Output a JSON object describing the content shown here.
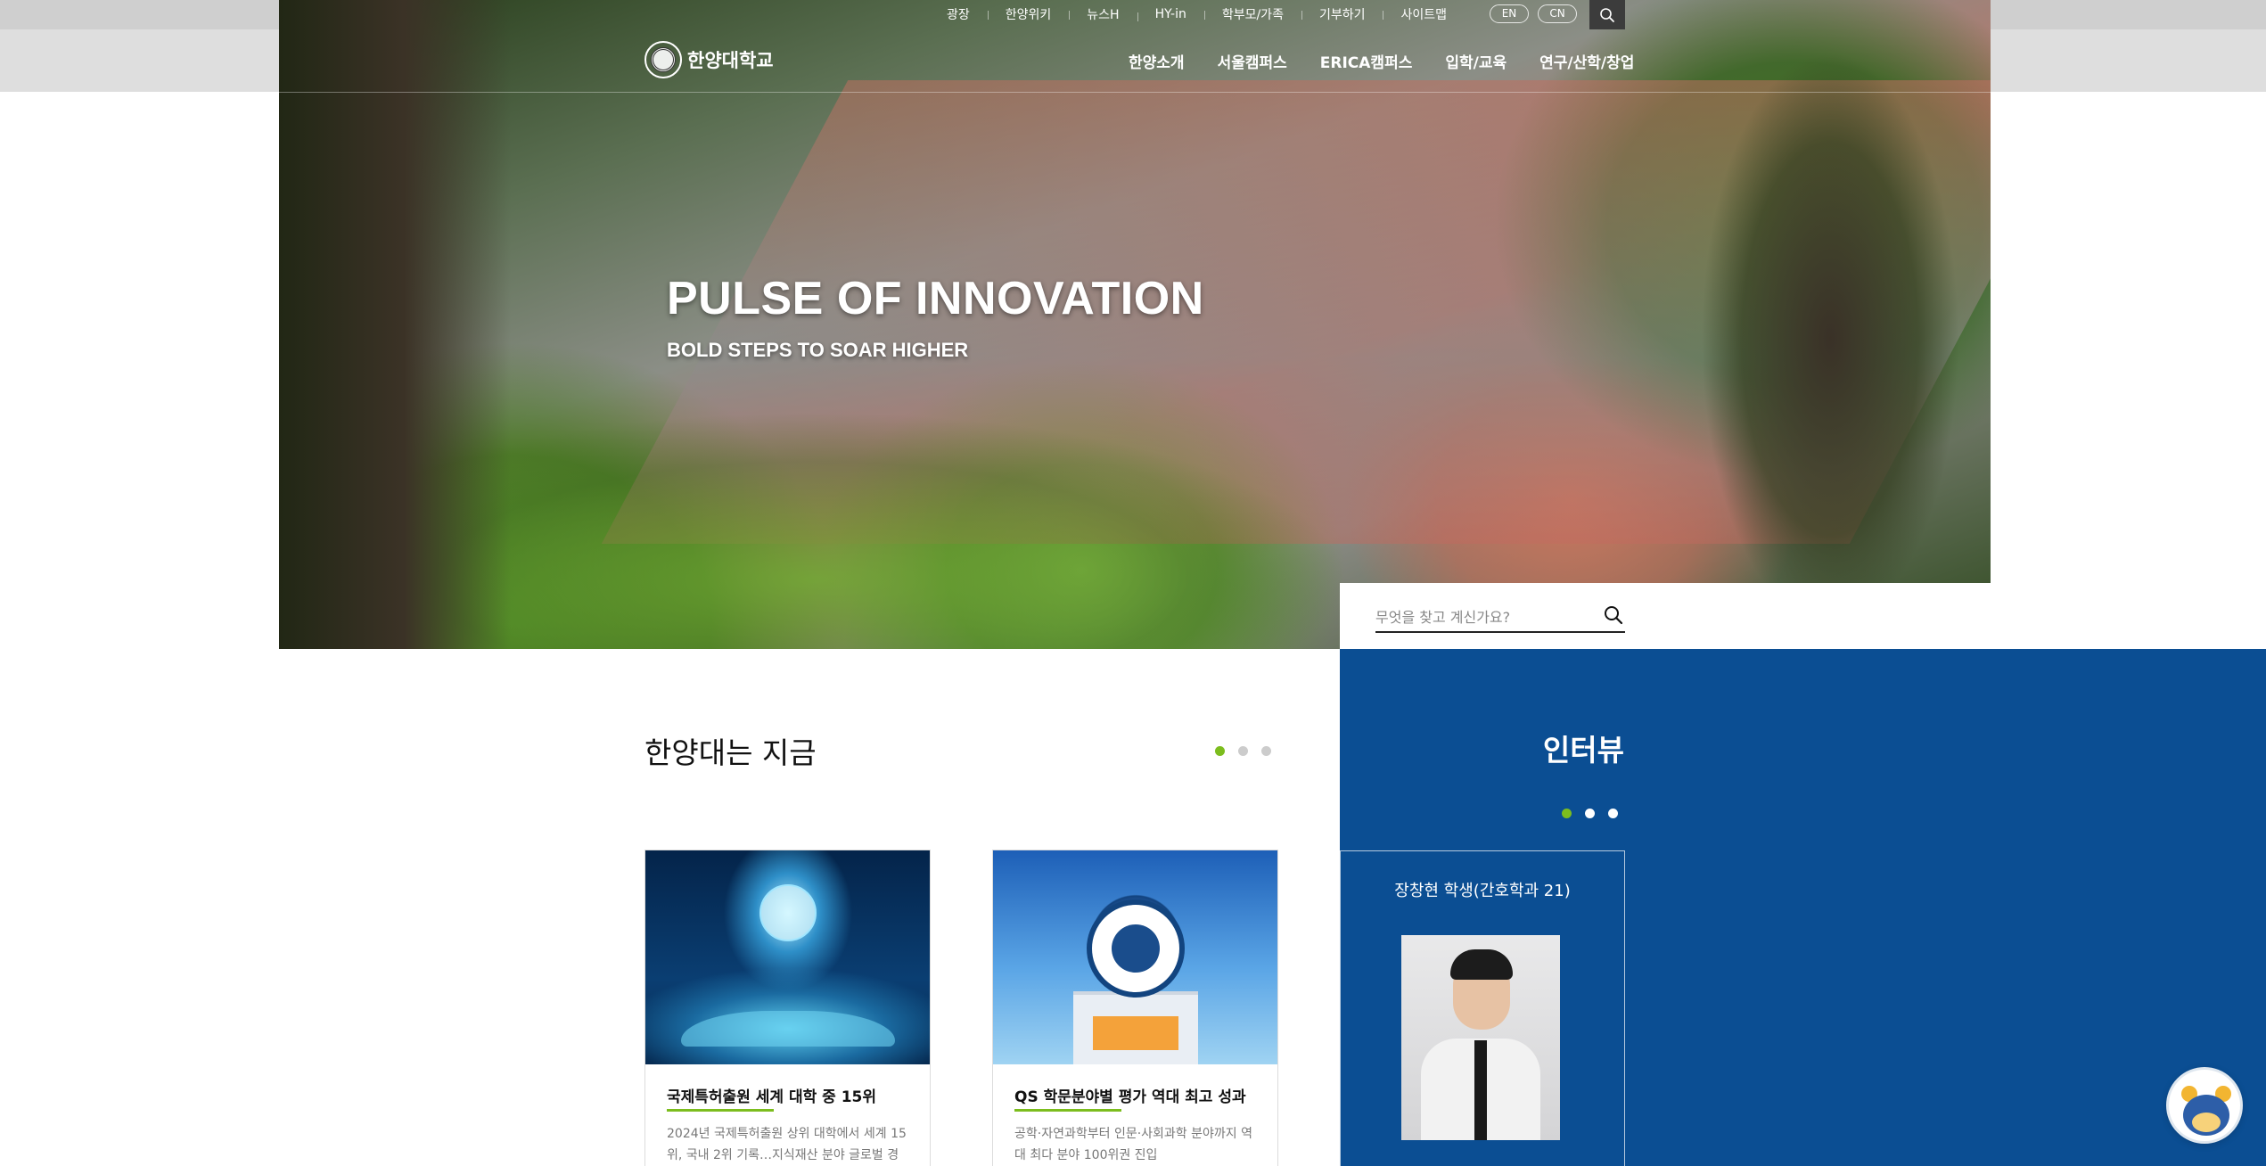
{
  "header": {
    "util_nav": [
      "광장",
      "한양위키",
      "뉴스H",
      "HY-in",
      "학부모/가족",
      "기부하기",
      "사이트맵"
    ],
    "lang_buttons": [
      "EN",
      "CN"
    ],
    "logo_text": "한양대학교",
    "gnb": [
      "한양소개",
      "서울캠퍼스",
      "ERICA캠퍼스",
      "입학/교육",
      "연구/산학/창업"
    ]
  },
  "hero": {
    "title": "PULSE OF INNOVATION",
    "subtitle": "BOLD STEPS TO SOAR HIGHER"
  },
  "search": {
    "placeholder": "무엇을 찾고 계신가요?",
    "icon": "search-icon"
  },
  "now_section": {
    "title": "한양대는 지금",
    "pager_active": 1,
    "pager_count": 3,
    "cards": [
      {
        "title": "국제특허출원 세계 대학 중 15위",
        "desc": "2024년 국제특허출원 상위 대학에서 세계 15위, 국내 2위 기록…지식재산 분야 글로벌 경"
      },
      {
        "title": "QS 학문분야별 평가 역대 최고 성과",
        "desc": "공학·자연과학부터 인문·사회과학 분야까지 역대 최다 분야 100위권 진입"
      }
    ]
  },
  "interview": {
    "title": "인터뷰",
    "pager_active": 1,
    "pager_count": 3,
    "name": "장창현 학생(간호학과 21)"
  },
  "colors": {
    "accent_green": "#7cbd1e",
    "panel_blue": "#0b4e93",
    "dot_inactive_gray": "#cccccc",
    "dot_inactive_white": "#ffffff"
  }
}
